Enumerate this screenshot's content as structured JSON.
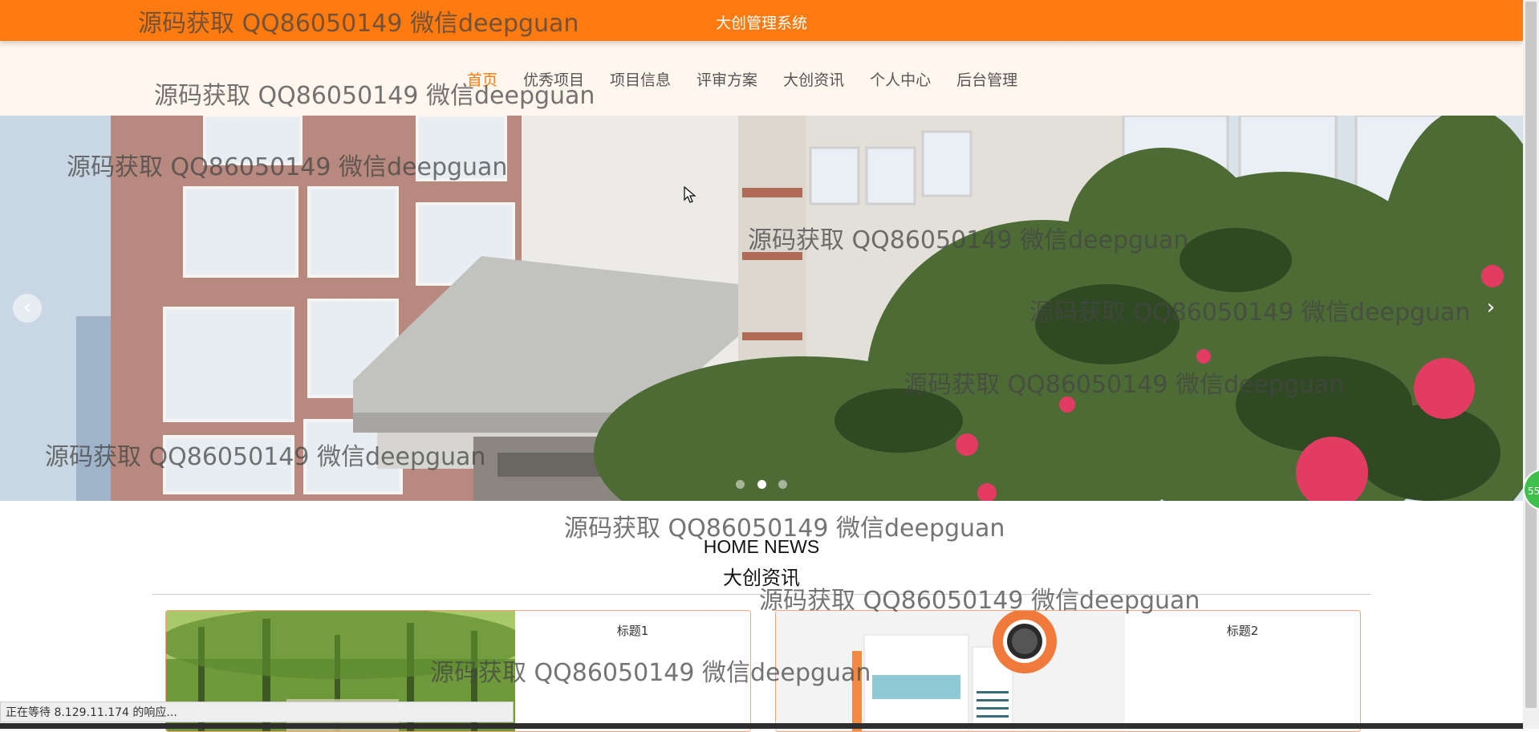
{
  "app": {
    "title": "大创管理系统"
  },
  "nav": {
    "items": [
      "首页",
      "优秀项目",
      "项目信息",
      "评审方案",
      "大创资讯",
      "个人中心",
      "后台管理"
    ],
    "active_index": 0
  },
  "banner": {
    "prev_label": "‹",
    "next_label": "›",
    "slide_count": 3,
    "active_slide": 1
  },
  "news_section": {
    "title_en": "HOME NEWS",
    "title_cn": "大创资讯"
  },
  "cards": [
    {
      "title": "标题1"
    },
    {
      "title": "标题2"
    }
  ],
  "status": {
    "text": "正在等待 8.129.11.174 的响应..."
  },
  "side_badge": {
    "text": "55"
  },
  "watermark": {
    "text": "源码获取 QQ86050149 微信deepguan"
  },
  "colors": {
    "accent": "#ff7a0f",
    "nav_bg": "#fff6ee",
    "card_border": "#f3a57c"
  }
}
